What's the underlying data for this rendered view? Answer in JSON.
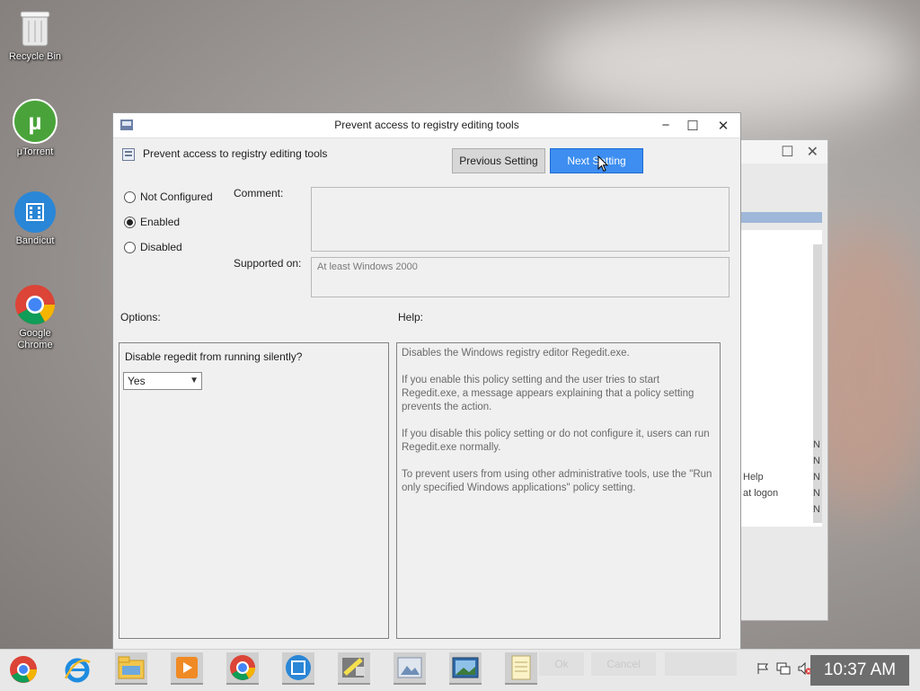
{
  "desktop": {
    "icons": [
      {
        "label": "Recycle Bin"
      },
      {
        "label": "μTorrent"
      },
      {
        "label": "Bandicut"
      },
      {
        "label": "Google Chrome"
      }
    ]
  },
  "bg_window": {
    "rows": [
      {
        "left": "",
        "right": "N"
      },
      {
        "left": "",
        "right": "N"
      },
      {
        "left": "Help",
        "right": "N"
      },
      {
        "left": "at logon",
        "right": "N"
      },
      {
        "left": "",
        "right": "N"
      }
    ]
  },
  "dialog": {
    "title": "Prevent access to registry editing tools",
    "header_text": "Prevent access to registry editing tools",
    "prev_button": "Previous Setting",
    "next_button": "Next Setting",
    "radios": [
      {
        "label": "Not Configured",
        "selected": false
      },
      {
        "label": "Enabled",
        "selected": true
      },
      {
        "label": "Disabled",
        "selected": false
      }
    ],
    "comment_label": "Comment:",
    "comment_value": "",
    "supported_label": "Supported on:",
    "supported_value": "At least Windows 2000",
    "options_label": "Options:",
    "help_label": "Help:",
    "option_question": "Disable regedit from running silently?",
    "option_select_value": "Yes",
    "help_paragraphs": [
      "Disables the Windows registry editor Regedit.exe.",
      "If you enable this policy setting and the user tries to start Regedit.exe, a message appears explaining that a policy setting prevents the action.",
      "If you disable this policy setting or do not configure it, users can run Regedit.exe normally.",
      "To prevent users from using other administrative tools, use the \"Run only specified Windows applications\" policy setting."
    ]
  },
  "taskbar": {
    "apps": [
      "chrome-rainbow-icon",
      "internet-explorer-icon",
      "file-explorer-icon",
      "media-player-icon",
      "chrome-icon",
      "bandicut-icon",
      "paint-icon",
      "gallery-icon",
      "photo-viewer-icon",
      "notepad-icon"
    ],
    "ghost_ok": "Ok",
    "ghost_cancel": "Cancel",
    "clock": "10:37 AM"
  }
}
